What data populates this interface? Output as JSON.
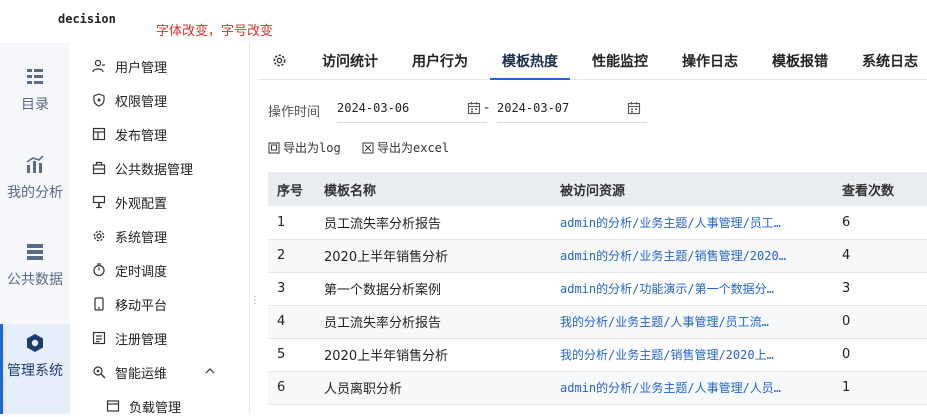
{
  "app": {
    "logo": "decision",
    "note": "字体改变，字号改变"
  },
  "rail": [
    {
      "label": "目录",
      "icon": "catalog-icon"
    },
    {
      "label": "我的分析",
      "icon": "analysis-icon"
    },
    {
      "label": "公共数据",
      "icon": "database-icon"
    },
    {
      "label": "管理系统",
      "icon": "manage-system-icon",
      "active": true
    }
  ],
  "menu": [
    {
      "label": "用户管理",
      "icon": "user-manage-icon"
    },
    {
      "label": "权限管理",
      "icon": "shield-icon"
    },
    {
      "label": "发布管理",
      "icon": "publish-icon"
    },
    {
      "label": "公共数据管理",
      "icon": "public-data-icon"
    },
    {
      "label": "外观配置",
      "icon": "appearance-icon"
    },
    {
      "label": "系统管理",
      "icon": "gear-icon"
    },
    {
      "label": "定时调度",
      "icon": "timer-icon"
    },
    {
      "label": "移动平台",
      "icon": "mobile-icon"
    },
    {
      "label": "注册管理",
      "icon": "register-icon"
    },
    {
      "label": "智能运维",
      "icon": "ops-icon",
      "expanded": true
    },
    {
      "label": "负载管理",
      "icon": "load-icon",
      "sub": true
    }
  ],
  "tabs": [
    "访问统计",
    "用户行为",
    "模板热度",
    "性能监控",
    "操作日志",
    "模板报错",
    "系统日志"
  ],
  "active_tab": "模板热度",
  "filter": {
    "label": "操作时间",
    "start": "2024-03-06",
    "separator": "-",
    "end": "2024-03-07"
  },
  "export": {
    "log": "导出为log",
    "excel": "导出为excel"
  },
  "table": {
    "headers": [
      "序号",
      "模板名称",
      "被访问资源",
      "查看次数"
    ],
    "rows": [
      [
        "1",
        "员工流失率分析报告",
        "admin的分析/业务主题/人事管理/员工…",
        "6"
      ],
      [
        "2",
        "2020上半年销售分析",
        "admin的分析/业务主题/销售管理/2020…",
        "4"
      ],
      [
        "3",
        "第一个数据分析案例",
        "admin的分析/功能演示/第一个数据分…",
        "3"
      ],
      [
        "4",
        "员工流失率分析报告",
        "我的分析/业务主题/人事管理/员工流…",
        "0"
      ],
      [
        "5",
        "2020上半年销售分析",
        "我的分析/业务主题/销售管理/2020上…",
        "0"
      ],
      [
        "6",
        "人员离职分析",
        "admin的分析/业务主题/人事管理/人员…",
        "1"
      ]
    ]
  },
  "colors": {
    "accent": "#1a66e0",
    "link": "#2565c9",
    "note": "#e0302b",
    "header_bg": "#e9ecf1"
  }
}
